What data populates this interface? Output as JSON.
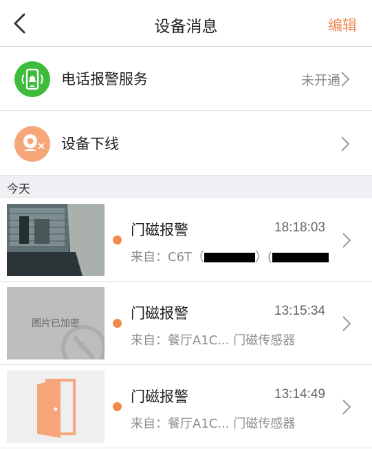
{
  "nav": {
    "title": "设备消息",
    "edit_label": "编辑"
  },
  "services": [
    {
      "label": "电话报警服务",
      "status": "未开通",
      "icon": "phone-alarm-icon",
      "color": "#3dbb3a"
    },
    {
      "label": "设备下线",
      "status": "",
      "icon": "camera-offline-icon",
      "color": "#f6a679"
    }
  ],
  "section": {
    "today": "今天"
  },
  "messages": [
    {
      "title": "门磁报警",
      "time": "18:18:03",
      "source_prefix": "来自：C6T（",
      "source_mid": "）(",
      "thumb": "camera-snapshot"
    },
    {
      "title": "门磁报警",
      "time": "13:15:34",
      "source": "来自：餐厅A1C... 门磁传感器",
      "thumb": "encrypted-image",
      "thumb_text": "图片已加密"
    },
    {
      "title": "门磁报警",
      "time": "13:14:49",
      "source": "来自：餐厅A1C... 门磁传感器",
      "thumb": "door-icon"
    }
  ],
  "colors": {
    "accent": "#ef8a52",
    "dot": "#f08a4b",
    "green": "#3dbb3a",
    "peach": "#f6a679"
  }
}
